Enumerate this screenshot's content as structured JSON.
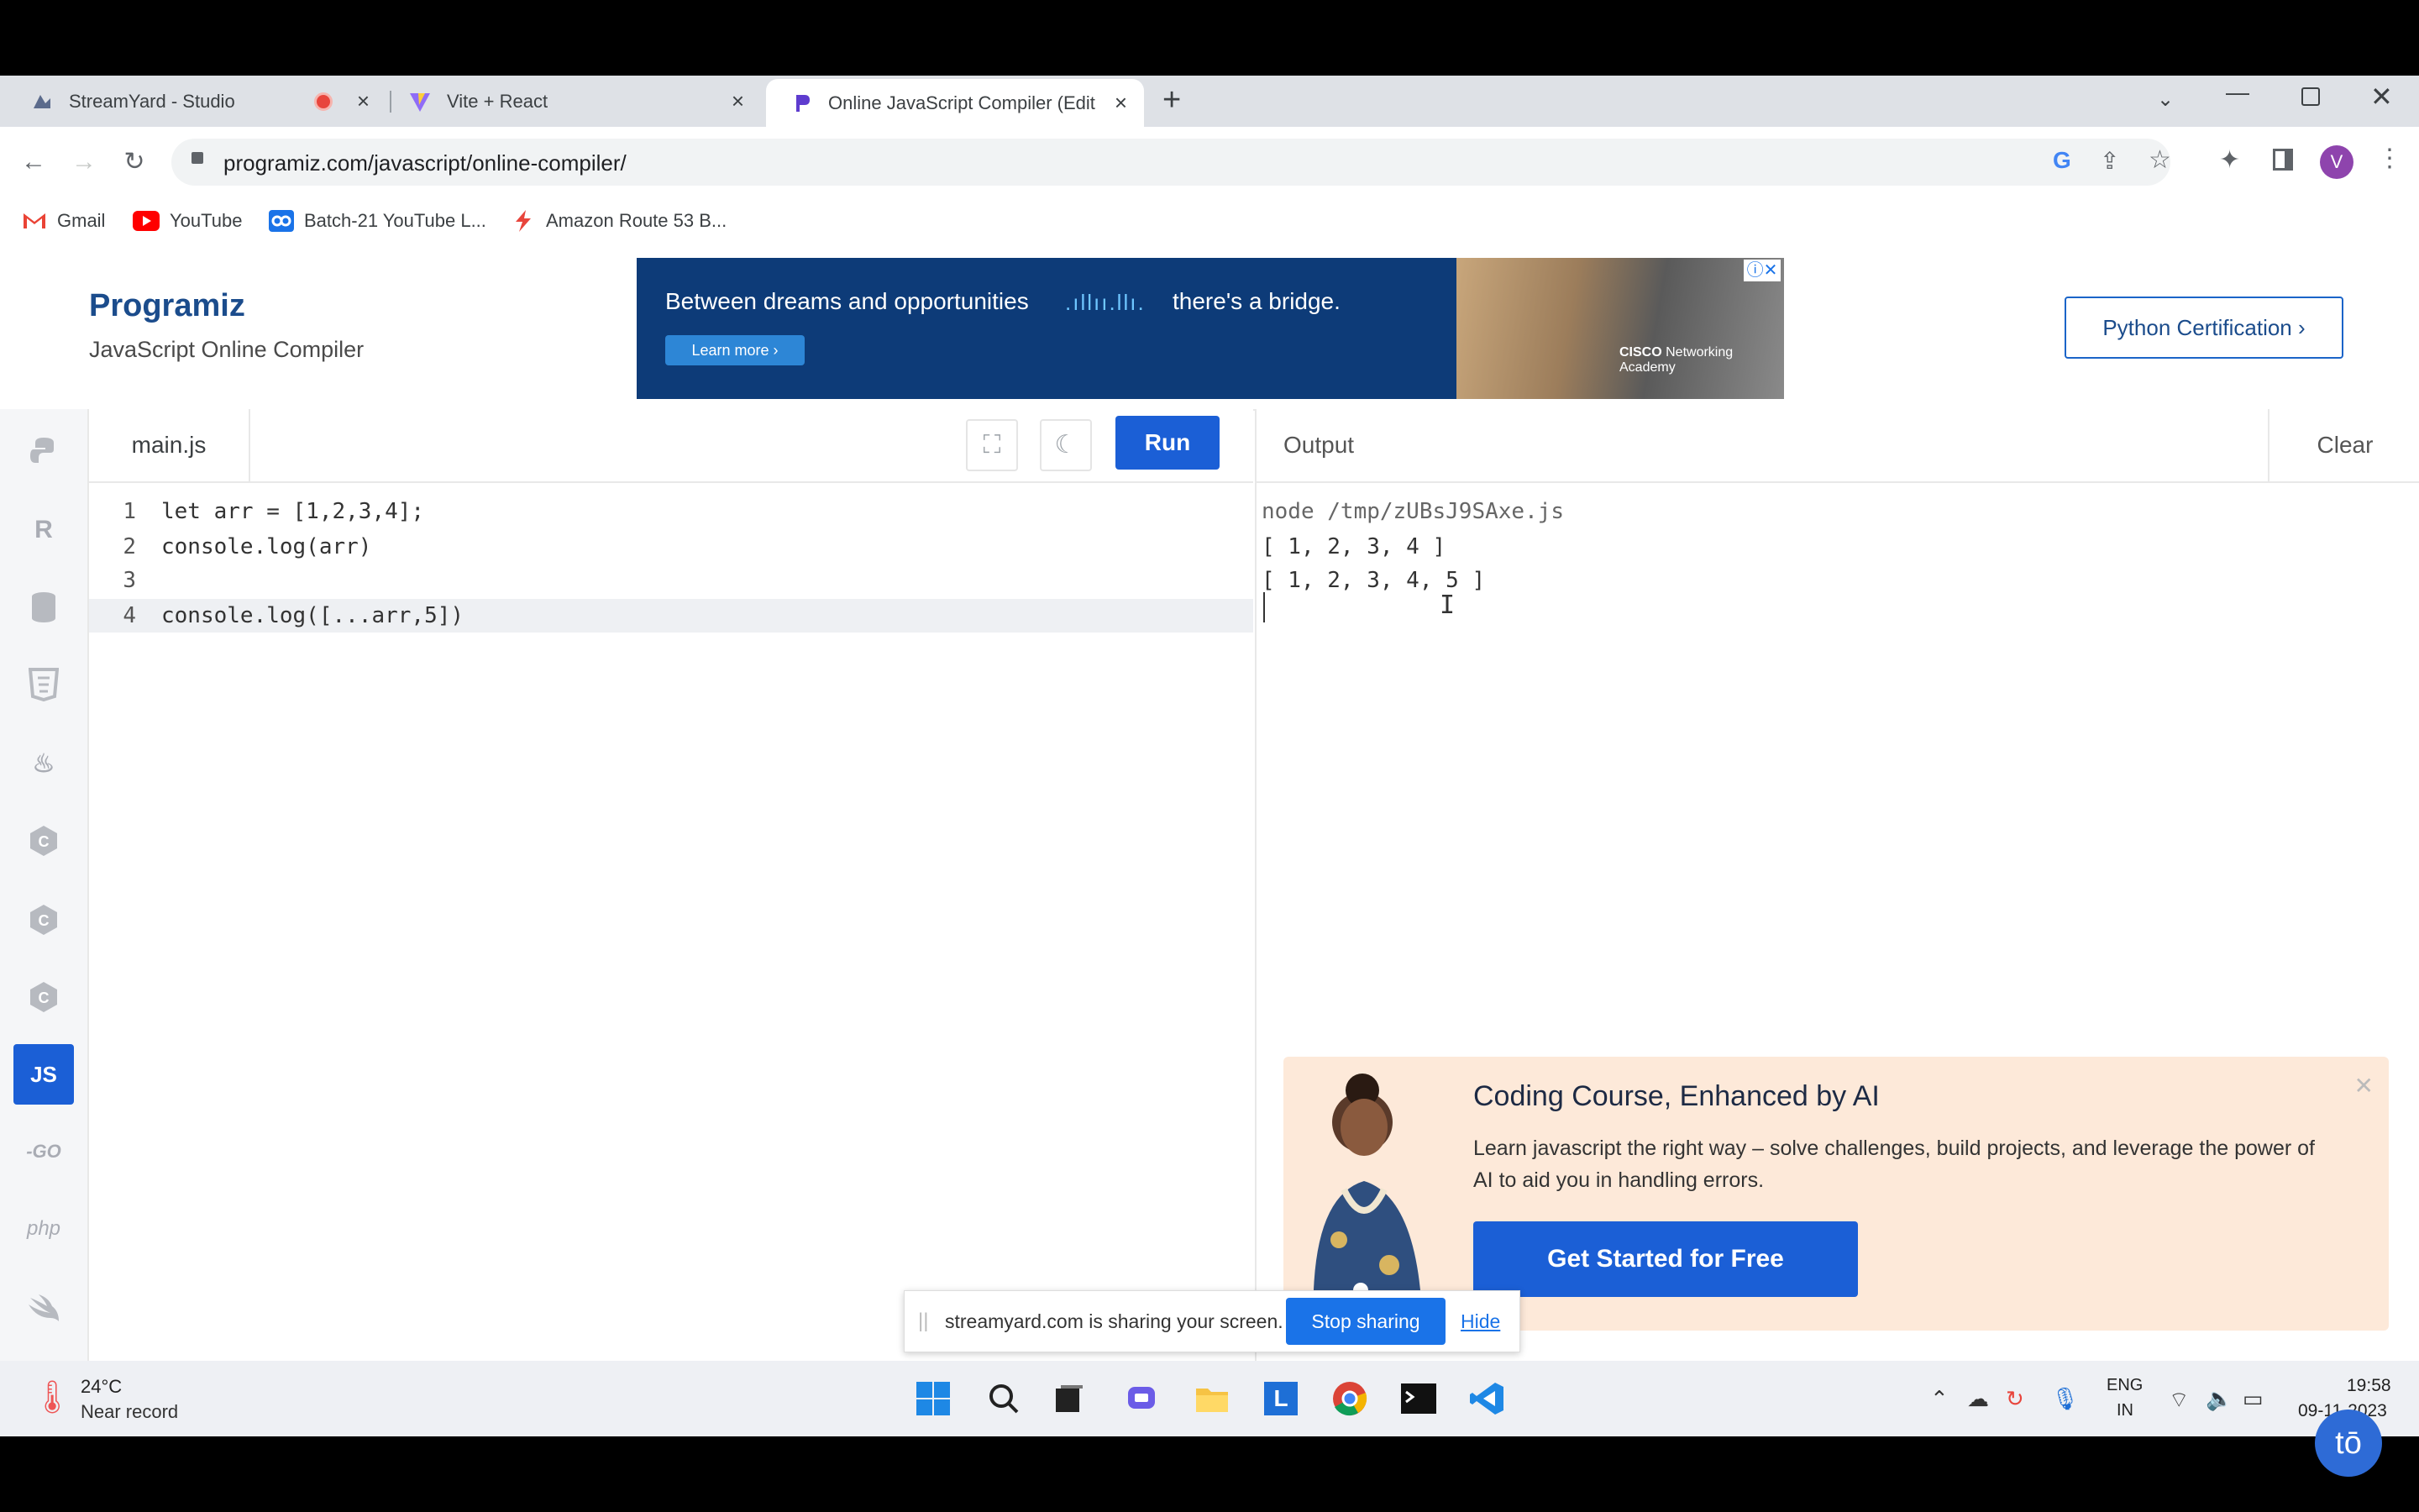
{
  "browser": {
    "tabs": [
      {
        "label": "StreamYard - Studio",
        "icon": "streamyard-icon",
        "recording": true
      },
      {
        "label": "Vite + React",
        "icon": "vite-icon"
      },
      {
        "label": "Online JavaScript Compiler (Edit",
        "icon": "programiz-icon",
        "active": true
      }
    ],
    "new_tab": "+",
    "url": "programiz.com/javascript/online-compiler/",
    "profile_initial": "V",
    "bookmarks": [
      {
        "label": "Gmail",
        "icon": "gmail-icon"
      },
      {
        "label": "YouTube",
        "icon": "youtube-icon"
      },
      {
        "label": "Batch-21 YouTube L...",
        "icon": "link-icon"
      },
      {
        "label": "Amazon Route 53 B...",
        "icon": "aws-icon"
      }
    ]
  },
  "header": {
    "logo": "Programiz",
    "subtitle": "JavaScript Online Compiler",
    "cert_button": "Python Certification ›",
    "ad": {
      "text1": "Between dreams and opportunities",
      "text2": "there's a bridge.",
      "cta": "Learn more ›",
      "brand": "Networking Academy"
    }
  },
  "sidebar": {
    "items": [
      {
        "name": "python-icon",
        "label": ""
      },
      {
        "name": "r-icon",
        "label": "R"
      },
      {
        "name": "sql-icon",
        "label": ""
      },
      {
        "name": "html-icon",
        "label": "5"
      },
      {
        "name": "java-icon",
        "label": "♨"
      },
      {
        "name": "c-icon",
        "label": "C"
      },
      {
        "name": "cpp-icon",
        "label": "C"
      },
      {
        "name": "csharp-icon",
        "label": "C"
      },
      {
        "name": "js-icon",
        "label": "JS",
        "active": true
      },
      {
        "name": "go-icon",
        "label": "-GO"
      },
      {
        "name": "php-icon",
        "label": "php"
      },
      {
        "name": "swift-icon",
        "label": ""
      }
    ]
  },
  "editor": {
    "file_tab": "main.js",
    "run_label": "Run",
    "lines": [
      {
        "num": "1",
        "text": "let arr = [1,2,3,4];"
      },
      {
        "num": "2",
        "text": "console.log(arr)"
      },
      {
        "num": "3",
        "text": ""
      },
      {
        "num": "4",
        "text": "console.log([...arr,5])"
      }
    ]
  },
  "output": {
    "title": "Output",
    "clear_label": "Clear",
    "lines": [
      "node /tmp/zUBsJ9SAxe.js",
      "[ 1, 2, 3, 4 ]",
      "[ 1, 2, 3, 4, 5 ]"
    ]
  },
  "promo": {
    "title": "Coding Course, Enhanced by AI",
    "body": "Learn javascript the right way – solve challenges, build projects, and leverage the power of AI to aid you in handling errors.",
    "cta": "Get Started for Free"
  },
  "sharebar": {
    "text": "streamyard.com is sharing your screen.",
    "stop": "Stop sharing",
    "hide": "Hide"
  },
  "taskbar": {
    "weather_temp": "24°C",
    "weather_desc": "Near record",
    "lang_line1": "ENG",
    "lang_line2": "IN",
    "time": "19:58",
    "date": "09-11-2023"
  },
  "colors": {
    "accent": "#1b5fd6",
    "brand": "#1b4c8c",
    "promo_bg": "#fde9d9"
  }
}
